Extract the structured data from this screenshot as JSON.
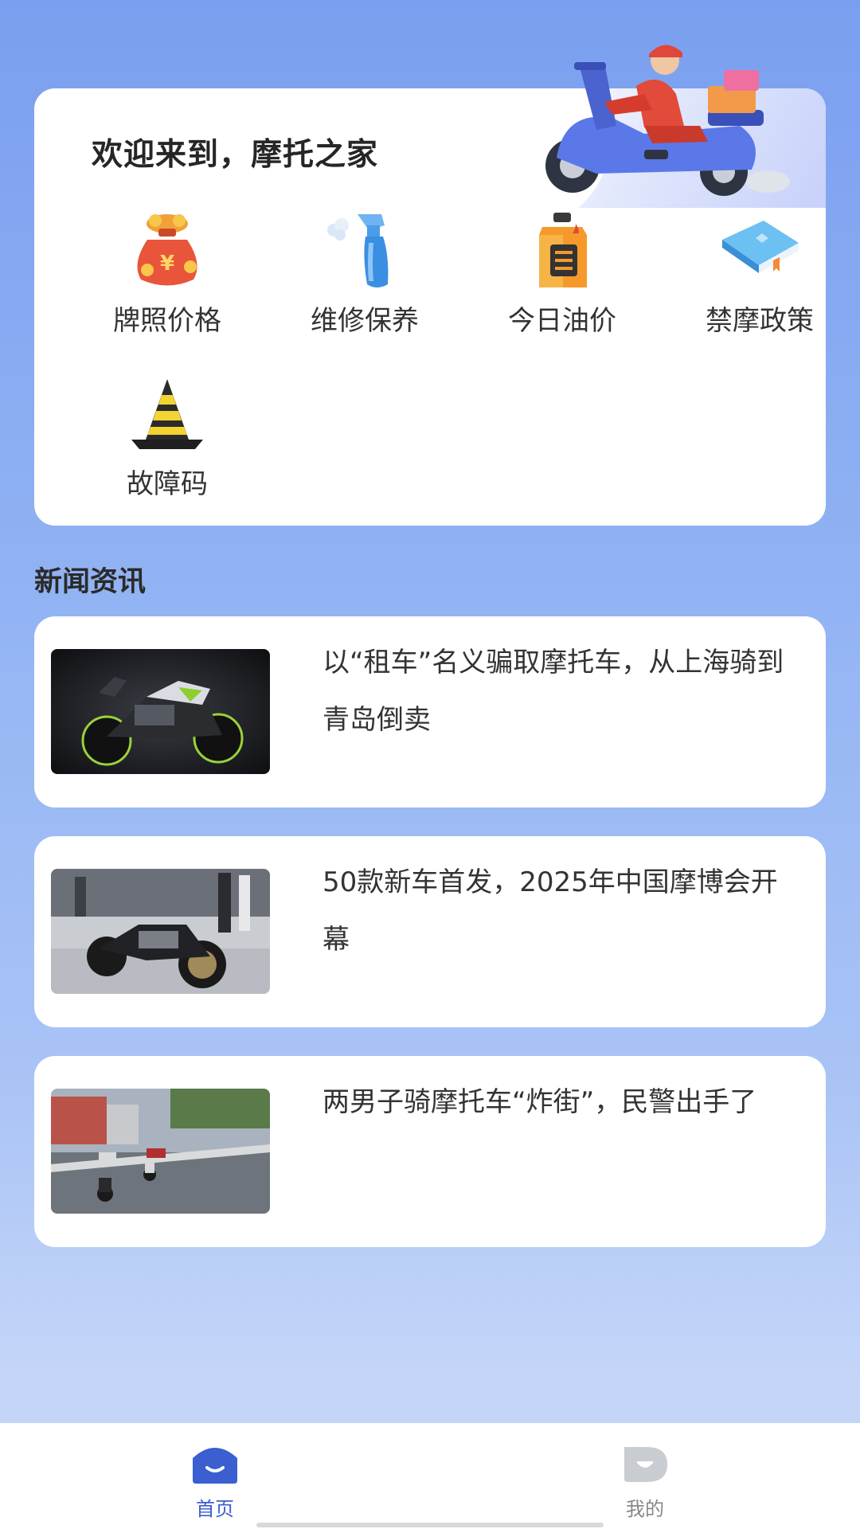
{
  "welcome": {
    "title": "欢迎来到，摩托之家"
  },
  "features": [
    {
      "label": "牌照价格",
      "icon": "money-bag-icon"
    },
    {
      "label": "维修保养",
      "icon": "spray-bottle-icon"
    },
    {
      "label": "今日油价",
      "icon": "oil-can-icon"
    },
    {
      "label": "禁摩政策",
      "icon": "book-icon"
    },
    {
      "label": "故障码",
      "icon": "traffic-cone-icon"
    }
  ],
  "news": {
    "heading": "新闻资讯",
    "items": [
      {
        "title": "以“租车”名义骗取摩托车，从上海骑到青岛倒卖",
        "thumb": "motorcycle-photo"
      },
      {
        "title": "50款新车首发，2025年中国摩博会开幕",
        "thumb": "expo-motorcycle-photo"
      },
      {
        "title": "两男子骑摩托车“炸街”，民警出手了",
        "thumb": "street-motorcycle-photo"
      }
    ]
  },
  "tabbar": {
    "home_label": "首页",
    "mine_label": "我的"
  },
  "colors": {
    "accent": "#3b5fd0",
    "background_top": "#7a9ff0",
    "background_bottom": "#c4d5f8"
  }
}
